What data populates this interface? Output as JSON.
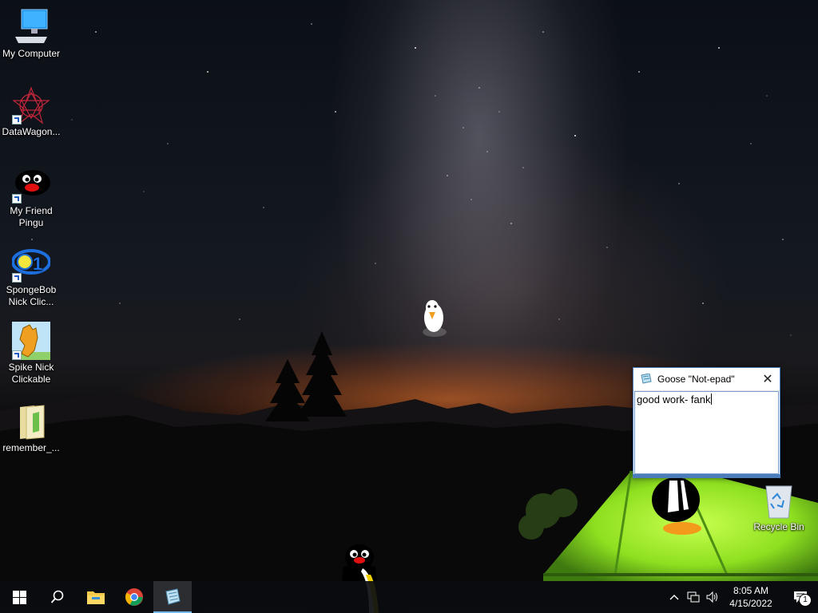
{
  "desktop": {
    "icons": [
      {
        "label": "My Computer",
        "icon": "computer-icon"
      },
      {
        "label": "DataWagon...",
        "icon": "datawagon-icon"
      },
      {
        "label": "My Friend Pingu",
        "icon": "pingu-icon"
      },
      {
        "label": "SpongeBob Nick Clic...",
        "icon": "spongebob-icon"
      },
      {
        "label": "Spike Nick Clickable",
        "icon": "spike-icon"
      },
      {
        "label": "remember_...",
        "icon": "folder-icon"
      },
      {
        "label": "Recycle Bin",
        "icon": "recycle-bin-icon"
      }
    ]
  },
  "notepad": {
    "title": "Goose \"Not-epad\"",
    "content": "good work- fank"
  },
  "taskbar": {
    "items": [
      "start-button",
      "search-button",
      "file-explorer",
      "chrome",
      "goose-notepad"
    ],
    "clock": {
      "time": "8:05 AM",
      "date": "4/15/2022"
    },
    "notification_count": "1"
  },
  "colors": {
    "taskbar": "#0a0c10",
    "active_indicator": "#76b9ed",
    "window_border": "#4a7dba",
    "tent_green": "#8fe020"
  }
}
